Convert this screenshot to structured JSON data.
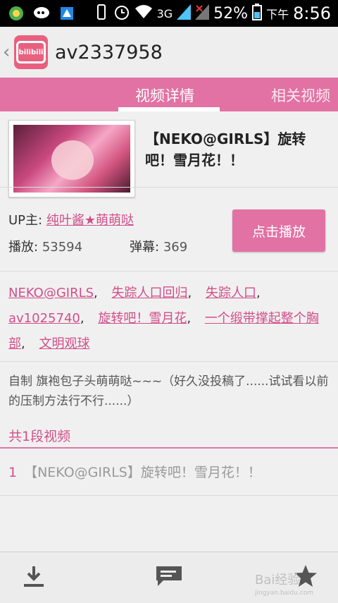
{
  "status_bar": {
    "network_type": "3G",
    "battery": "52%",
    "am_pm": "下午",
    "time": "8:56"
  },
  "header": {
    "back_icon": "chevron-left-icon",
    "logo_text": "bilibili",
    "title": "av2337958"
  },
  "tabs": [
    {
      "label": "视频详情",
      "active": true
    },
    {
      "label": "相关视频",
      "active": false
    }
  ],
  "video": {
    "title": "【NEKO@GIRLS】旋转吧！雪月花！！",
    "uploader_label": "UP主:",
    "uploader_name": "纯叶酱★萌萌哒",
    "plays_label": "播放:",
    "plays": "53594",
    "danmaku_label": "弹幕:",
    "danmaku": "369",
    "play_button": "点击播放"
  },
  "tags": [
    "NEKO@GIRLS",
    "失踪人口回归",
    "失踪人口",
    "av1025740",
    "旋转吧！雪月花",
    "一个缎带撑起整个胸部",
    "文明观球"
  ],
  "description": "自制 旗袍包子头萌萌哒~~~（好久没投稿了......试试看以前的压制方法行不行......）",
  "parts_section": {
    "title": "共1段视频",
    "items": [
      {
        "index": "1",
        "title": "【NEKO@GIRLS】旋转吧！雪月花！！"
      }
    ]
  },
  "bottom_bar": {
    "icons": [
      "download-icon",
      "comment-icon",
      "favorite-star-icon"
    ]
  },
  "watermark": {
    "text": "Bai经验",
    "url": "jingyan.baidu.com"
  },
  "colors": {
    "accent": "#e272a4",
    "link": "#d04f8a"
  }
}
